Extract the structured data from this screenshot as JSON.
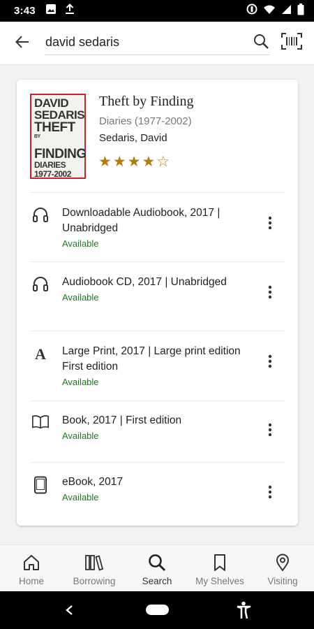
{
  "status_bar": {
    "time": "3:43",
    "left_icons": [
      "image-icon",
      "download-icon"
    ],
    "right_icons": [
      "do-not-disturb-icon",
      "wifi-icon",
      "signal-icon",
      "battery-icon"
    ]
  },
  "search": {
    "query": "david sedaris",
    "back_icon": "arrow-left-icon",
    "search_icon": "search-icon",
    "barcode_icon": "barcode-scan-icon"
  },
  "result": {
    "cover": {
      "author": "DAVID SEDARIS",
      "author_line1": "DAVID",
      "author_line2": "SEDARIS",
      "title_line1": "THEFT",
      "title_by": "BY",
      "title_line2": "FINDING",
      "sub_line1": "DIARIES",
      "sub_line2": "1977-2002",
      "border_color": "#c8232c"
    },
    "title": "Theft by Finding",
    "subtitle": "Diaries (1977-2002)",
    "author": "Sedaris, David",
    "rating": 4,
    "rating_max": 5,
    "star_color": "#b37d0e",
    "formats": [
      {
        "icon": "headphones-icon",
        "label": "Downloadable Audiobook, 2017 | Unabridged",
        "status": "Available"
      },
      {
        "icon": "headphones-icon",
        "label": "Audiobook CD, 2017 | Unabridged",
        "status": "Available"
      },
      {
        "icon": "large-print-icon",
        "label": "Large Print, 2017 | Large print edition First edition",
        "status": "Available"
      },
      {
        "icon": "open-book-icon",
        "label": "Book, 2017 | First edition",
        "status": "Available"
      },
      {
        "icon": "tablet-icon",
        "label": "eBook, 2017",
        "status": "Available"
      }
    ],
    "status_color": "#1e7a1e"
  },
  "bottom_nav": {
    "items": [
      {
        "label": "Home",
        "icon": "home-icon",
        "active": false
      },
      {
        "label": "Borrowing",
        "icon": "books-icon",
        "active": false
      },
      {
        "label": "Search",
        "icon": "search-icon",
        "active": true
      },
      {
        "label": "My Shelves",
        "icon": "bookmark-icon",
        "active": false
      },
      {
        "label": "Visiting",
        "icon": "location-pin-icon",
        "active": false
      }
    ]
  },
  "system_nav": {
    "icons": [
      "back-triangle-icon",
      "home-pill-icon",
      "accessibility-icon"
    ]
  }
}
